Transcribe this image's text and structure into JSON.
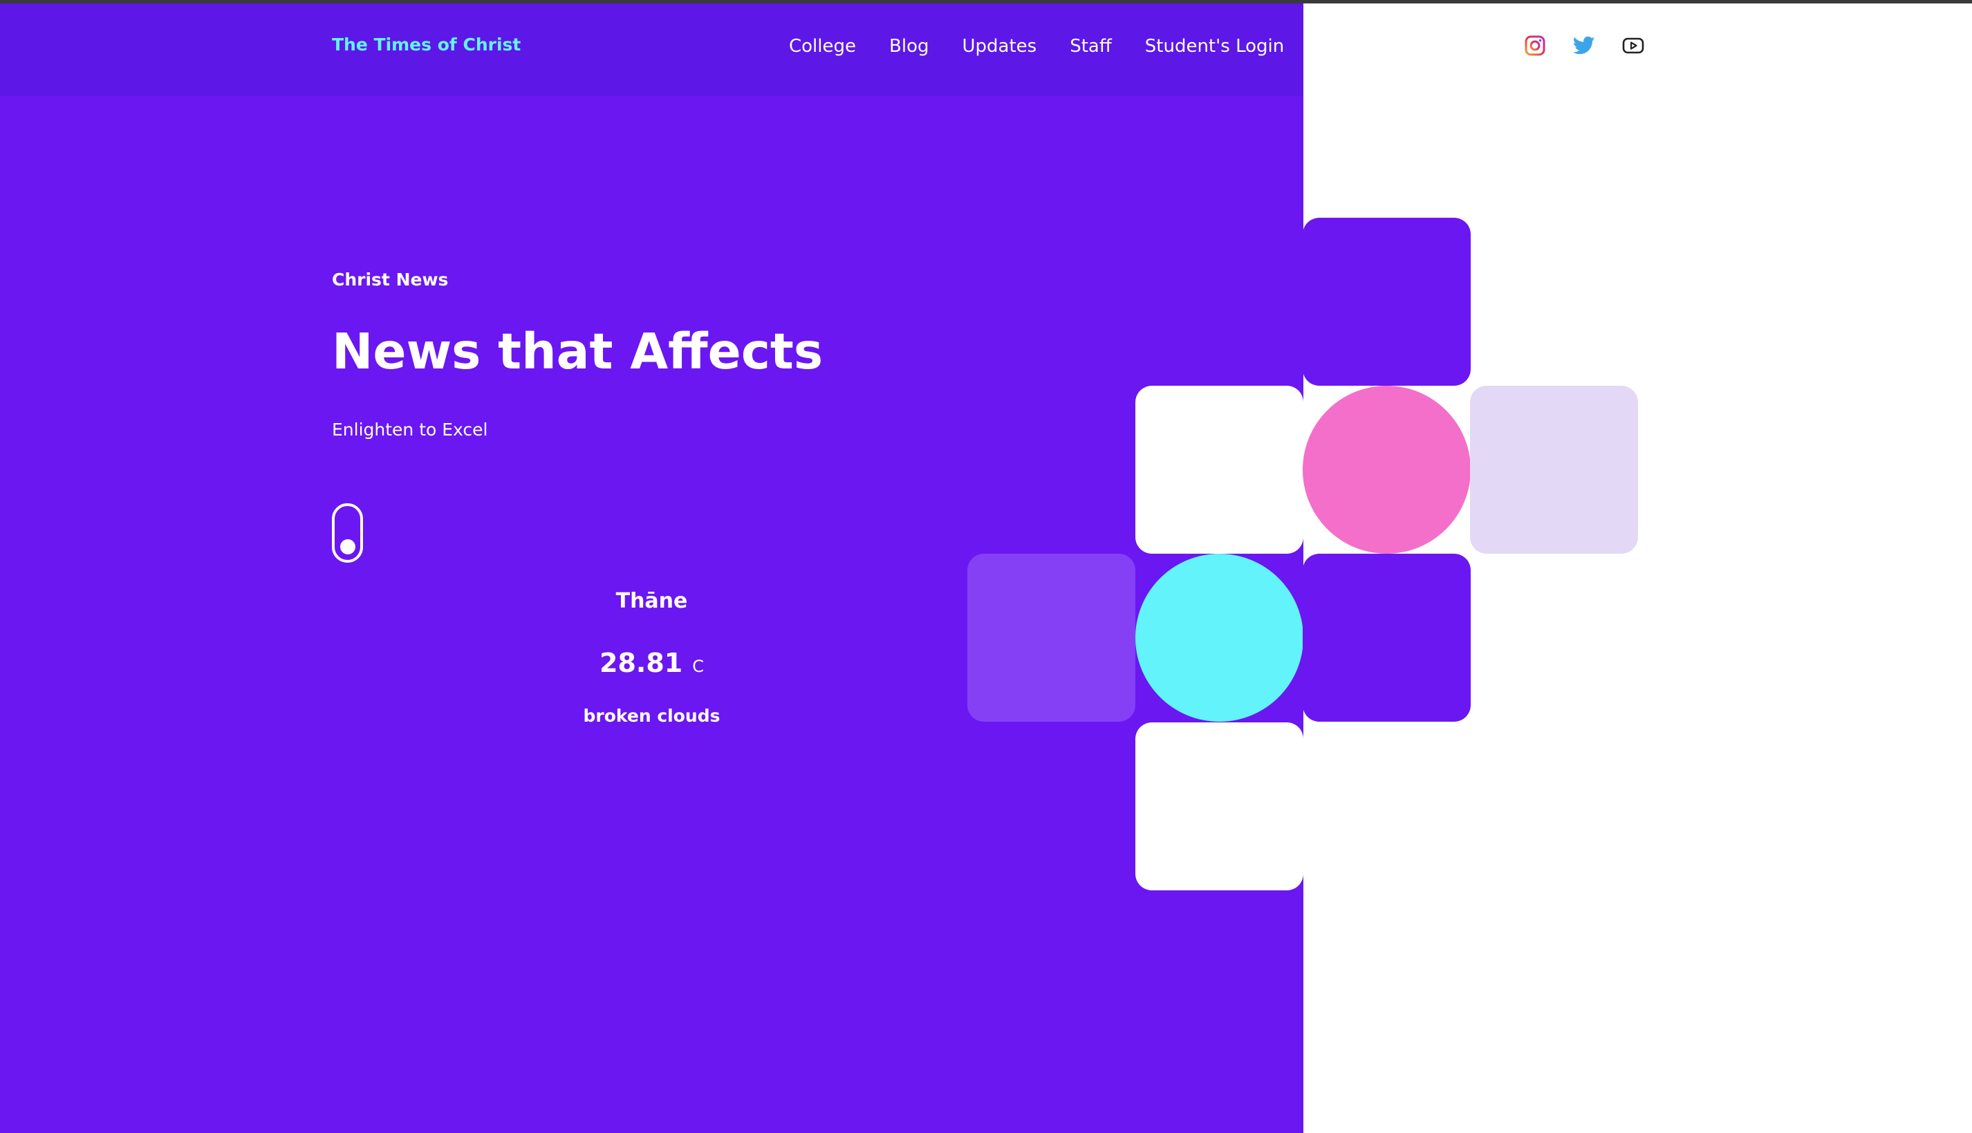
{
  "brand": {
    "name": "The Times of Christ"
  },
  "nav": {
    "items": [
      {
        "label": "College"
      },
      {
        "label": "Blog"
      },
      {
        "label": "Updates"
      },
      {
        "label": "Staff"
      },
      {
        "label": "Student's Login"
      }
    ]
  },
  "social": {
    "icons": [
      "instagram-icon",
      "twitter-icon",
      "youtube-icon"
    ]
  },
  "hero": {
    "eyebrow": "Christ News",
    "title": "News that Affects",
    "tagline": "Enlighten to Excel"
  },
  "weather": {
    "city": "Thāne",
    "temperature": "28.81",
    "unit": "C",
    "description": "broken clouds"
  },
  "colors": {
    "primary_purple": "#6a17f2",
    "header_purple": "#5d17e6",
    "brand_cyan": "#62f3fb",
    "pink": "#f36fc9",
    "lavender": "#e3d8f6",
    "light_purple": "#8540f6",
    "white": "#ffffff"
  }
}
